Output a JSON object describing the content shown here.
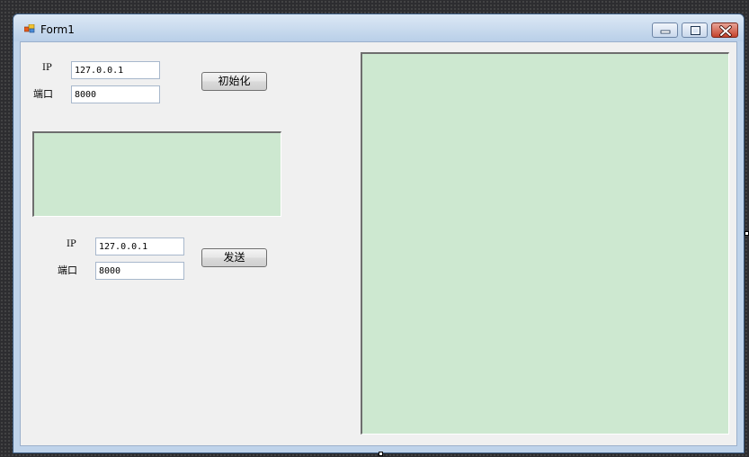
{
  "window": {
    "title": "Form1",
    "icon": "form-app-icon",
    "caption_buttons": [
      "minimize-icon",
      "maximize-icon",
      "close-icon"
    ]
  },
  "init_group": {
    "ip_label": "IP",
    "ip_value": "127.0.0.1",
    "port_label": "端口",
    "port_value": "8000",
    "init_button": "初始化"
  },
  "send_group": {
    "ip_label": "IP",
    "ip_value": "127.0.0.1",
    "port_label": "端口",
    "port_value": "8000",
    "send_button": "发送"
  },
  "colors": {
    "panel_fill": "#cde8d0",
    "form_background": "#f0f0f0",
    "titlebar": "#bfd3ea",
    "close_button": "#c5422b"
  }
}
